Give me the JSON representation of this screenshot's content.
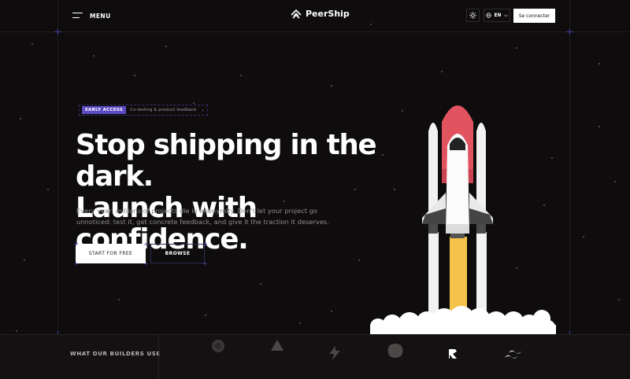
{
  "header": {
    "menu_label": "MENU",
    "logo_text": "PeerShip",
    "theme_icon": "sun-icon",
    "language": "EN",
    "connect_label": "Se connecter"
  },
  "hero": {
    "badge_tag": "EARLY ACCESS",
    "badge_text": "Co-testing & product feedback",
    "badge_arrow": "›",
    "headline_line1": "Stop shipping in the dark.",
    "headline_line2": "Launch with confidence.",
    "subtitle": "Every year, millions of projects die in anonymity. Don't let your project go unnoticed: test it, get concrete feedback, and give it the traction it deserves.",
    "primary_cta": "START FOR FREE",
    "secondary_cta": "BROWSE"
  },
  "builders": {
    "label": "WHAT OUR BUILDERS USE",
    "tools": [
      "github-icon",
      "vercel-icon",
      "bolt-icon",
      "shape-icon",
      "replit-icon",
      "tailwind-icon"
    ]
  },
  "colors": {
    "background": "#0e0c0c",
    "accent": "#5b4bc4",
    "rocket_red": "#e0535f",
    "flame": "#f6c34a"
  }
}
